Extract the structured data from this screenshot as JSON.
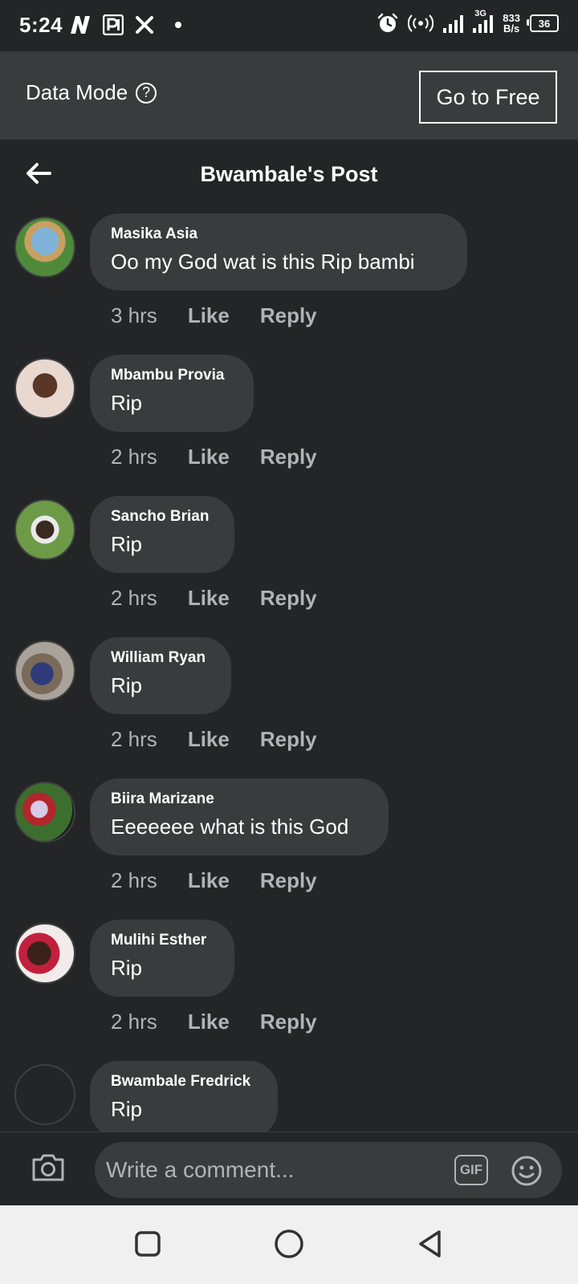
{
  "status_bar": {
    "time": "5:24",
    "notif_icons": [
      "n-logo-icon",
      "parking-p-icon",
      "x-logo-icon"
    ],
    "network_type": "3G",
    "speed_value": "833",
    "speed_unit": "B/s",
    "battery": "36"
  },
  "banner": {
    "label": "Data Mode",
    "help_glyph": "?",
    "go_free_label": "Go to Free"
  },
  "header": {
    "title": "Bwambale's Post"
  },
  "comments": [
    {
      "author": "Masika Asia",
      "text": "Oo my God wat is this Rip bambi",
      "time": "3 hrs",
      "like": "Like",
      "reply": "Reply"
    },
    {
      "author": "Mbambu Provia",
      "text": "Rip",
      "time": "2 hrs",
      "like": "Like",
      "reply": "Reply"
    },
    {
      "author": "Sancho Brian",
      "text": "Rip",
      "time": "2 hrs",
      "like": "Like",
      "reply": "Reply"
    },
    {
      "author": "William Ryan",
      "text": "Rip",
      "time": "2 hrs",
      "like": "Like",
      "reply": "Reply"
    },
    {
      "author": "Biira Marizane",
      "text": "Eeeeeee what is this God",
      "time": "2 hrs",
      "like": "Like",
      "reply": "Reply"
    },
    {
      "author": "Mulihi Esther",
      "text": "Rip",
      "time": "2 hrs",
      "like": "Like",
      "reply": "Reply"
    },
    {
      "author": "Bwambale Fredrick",
      "text": "Rip",
      "time": "",
      "like": "",
      "reply": ""
    }
  ],
  "composer": {
    "placeholder": "Write a comment...",
    "gif_label": "GIF"
  },
  "colors": {
    "background": "#242526",
    "bubble": "#3a3b3c",
    "secondary_text": "#b0b3b8",
    "nav_bar": "#f0f0f0"
  }
}
